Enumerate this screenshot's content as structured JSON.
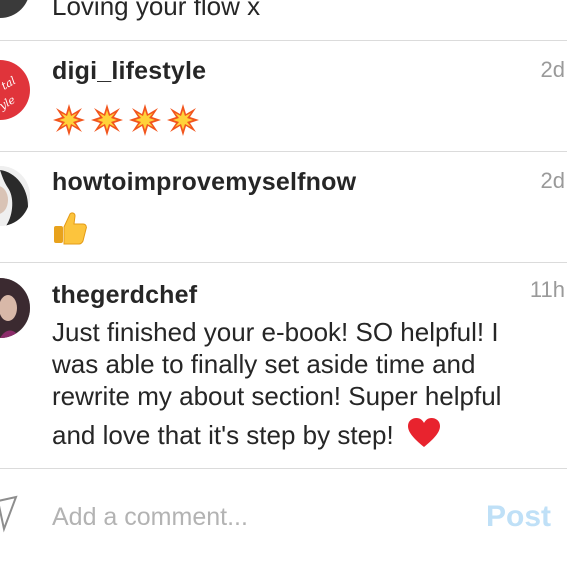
{
  "comments": [
    {
      "text": "Loving your flow x"
    },
    {
      "username": "digi_lifestyle",
      "time": "2d",
      "emoji": [
        "collision",
        "collision",
        "collision",
        "collision"
      ]
    },
    {
      "username": "howtoimprovemyselfnow",
      "time": "2d",
      "emoji": [
        "thumbs-up"
      ]
    },
    {
      "username": "thegerdchef",
      "time": "11h",
      "lines": [
        "Just finished your e-book! SO helpful! I",
        "was able to finally set aside time and",
        "rewrite my about section! Super helpful",
        "and love that it's step by step!"
      ]
    }
  ],
  "composer": {
    "placeholder": "Add a comment...",
    "post_label": "Post"
  },
  "colors": {
    "divider": "#dbdbdb",
    "username": "#262626",
    "timestamp": "#9a9a9a",
    "placeholder": "#b3b3b3",
    "post_disabled": "#bfe0f7",
    "avatar_red": "#e0343b",
    "heart": "#e8232e"
  }
}
